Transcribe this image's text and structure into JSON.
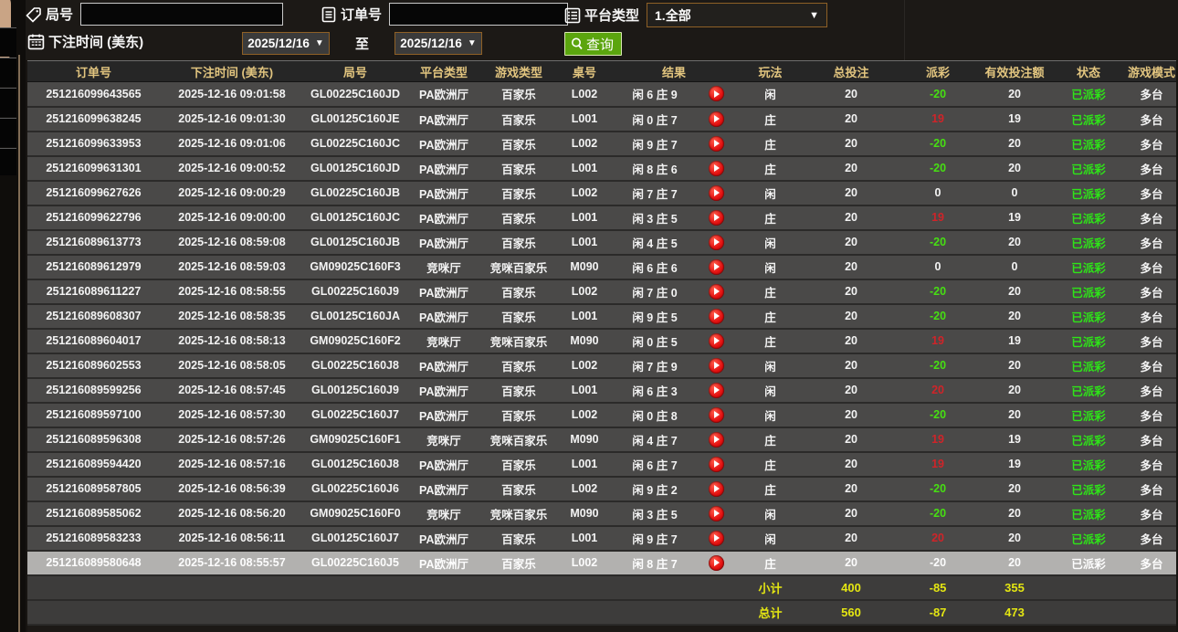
{
  "colors": {
    "accent_gold_header": "#e2c57f",
    "button_green": "#5ba50e",
    "payout_win_red": "#cf2429",
    "payout_loss_green": "#46df12",
    "status_green": "#2ee418",
    "total_yellow": "#e4e612",
    "row_bg": "#4a4948",
    "highlight_row_bg": "#b2b1af",
    "date_border_orange": "#8e6026"
  },
  "filters": {
    "round_label": "局号",
    "order_label": "订单号",
    "platform_label": "平台类型",
    "platform_value": "1.全部",
    "time_label": "下注时间 (美东)",
    "date_from": "2025/12/16",
    "to_label": "至",
    "date_to": "2025/12/16",
    "search_label": "查询",
    "round_value": "",
    "order_value": ""
  },
  "table": {
    "headers": [
      "订单号",
      "下注时间 (美东)",
      "局号",
      "平台类型",
      "游戏类型",
      "桌号",
      "结果",
      "玩法",
      "总投注",
      "派彩",
      "有效投注额",
      "状态",
      "游戏模式"
    ],
    "rows": [
      {
        "order_no": "251216099643565",
        "bet_time": "2025-12-16 09:01:58",
        "round_no": "GL00225C160JD",
        "platform": "PA欧洲厅",
        "game_type": "百家乐",
        "table_no": "L002",
        "result": "闲 6 庄 9",
        "bet_type": "闲",
        "total_bet": "20",
        "payout": "-20",
        "valid_bet": "20",
        "status": "已派彩",
        "game_mode": "多台",
        "highlighted": false
      },
      {
        "order_no": "251216099638245",
        "bet_time": "2025-12-16 09:01:30",
        "round_no": "GL00125C160JE",
        "platform": "PA欧洲厅",
        "game_type": "百家乐",
        "table_no": "L001",
        "result": "闲 0 庄 7",
        "bet_type": "庄",
        "total_bet": "20",
        "payout": "19",
        "valid_bet": "19",
        "status": "已派彩",
        "game_mode": "多台",
        "highlighted": false
      },
      {
        "order_no": "251216099633953",
        "bet_time": "2025-12-16 09:01:06",
        "round_no": "GL00225C160JC",
        "platform": "PA欧洲厅",
        "game_type": "百家乐",
        "table_no": "L002",
        "result": "闲 9 庄 7",
        "bet_type": "庄",
        "total_bet": "20",
        "payout": "-20",
        "valid_bet": "20",
        "status": "已派彩",
        "game_mode": "多台",
        "highlighted": false
      },
      {
        "order_no": "251216099631301",
        "bet_time": "2025-12-16 09:00:52",
        "round_no": "GL00125C160JD",
        "platform": "PA欧洲厅",
        "game_type": "百家乐",
        "table_no": "L001",
        "result": "闲 8 庄 6",
        "bet_type": "庄",
        "total_bet": "20",
        "payout": "-20",
        "valid_bet": "20",
        "status": "已派彩",
        "game_mode": "多台",
        "highlighted": false
      },
      {
        "order_no": "251216099627626",
        "bet_time": "2025-12-16 09:00:29",
        "round_no": "GL00225C160JB",
        "platform": "PA欧洲厅",
        "game_type": "百家乐",
        "table_no": "L002",
        "result": "闲 7 庄 7",
        "bet_type": "闲",
        "total_bet": "20",
        "payout": "0",
        "valid_bet": "0",
        "status": "已派彩",
        "game_mode": "多台",
        "highlighted": false
      },
      {
        "order_no": "251216099622796",
        "bet_time": "2025-12-16 09:00:00",
        "round_no": "GL00125C160JC",
        "platform": "PA欧洲厅",
        "game_type": "百家乐",
        "table_no": "L001",
        "result": "闲 3 庄 5",
        "bet_type": "庄",
        "total_bet": "20",
        "payout": "19",
        "valid_bet": "19",
        "status": "已派彩",
        "game_mode": "多台",
        "highlighted": false
      },
      {
        "order_no": "251216089613773",
        "bet_time": "2025-12-16 08:59:08",
        "round_no": "GL00125C160JB",
        "platform": "PA欧洲厅",
        "game_type": "百家乐",
        "table_no": "L001",
        "result": "闲 4 庄 5",
        "bet_type": "闲",
        "total_bet": "20",
        "payout": "-20",
        "valid_bet": "20",
        "status": "已派彩",
        "game_mode": "多台",
        "highlighted": false
      },
      {
        "order_no": "251216089612979",
        "bet_time": "2025-12-16 08:59:03",
        "round_no": "GM09025C160F3",
        "platform": "竞咪厅",
        "game_type": "竞咪百家乐",
        "table_no": "M090",
        "result": "闲 6 庄 6",
        "bet_type": "闲",
        "total_bet": "20",
        "payout": "0",
        "valid_bet": "0",
        "status": "已派彩",
        "game_mode": "多台",
        "highlighted": false
      },
      {
        "order_no": "251216089611227",
        "bet_time": "2025-12-16 08:58:55",
        "round_no": "GL00225C160J9",
        "platform": "PA欧洲厅",
        "game_type": "百家乐",
        "table_no": "L002",
        "result": "闲 7 庄 0",
        "bet_type": "庄",
        "total_bet": "20",
        "payout": "-20",
        "valid_bet": "20",
        "status": "已派彩",
        "game_mode": "多台",
        "highlighted": false
      },
      {
        "order_no": "251216089608307",
        "bet_time": "2025-12-16 08:58:35",
        "round_no": "GL00125C160JA",
        "platform": "PA欧洲厅",
        "game_type": "百家乐",
        "table_no": "L001",
        "result": "闲 9 庄 5",
        "bet_type": "庄",
        "total_bet": "20",
        "payout": "-20",
        "valid_bet": "20",
        "status": "已派彩",
        "game_mode": "多台",
        "highlighted": false
      },
      {
        "order_no": "251216089604017",
        "bet_time": "2025-12-16 08:58:13",
        "round_no": "GM09025C160F2",
        "platform": "竞咪厅",
        "game_type": "竞咪百家乐",
        "table_no": "M090",
        "result": "闲 0 庄 5",
        "bet_type": "庄",
        "total_bet": "20",
        "payout": "19",
        "valid_bet": "19",
        "status": "已派彩",
        "game_mode": "多台",
        "highlighted": false
      },
      {
        "order_no": "251216089602553",
        "bet_time": "2025-12-16 08:58:05",
        "round_no": "GL00225C160J8",
        "platform": "PA欧洲厅",
        "game_type": "百家乐",
        "table_no": "L002",
        "result": "闲 7 庄 9",
        "bet_type": "闲",
        "total_bet": "20",
        "payout": "-20",
        "valid_bet": "20",
        "status": "已派彩",
        "game_mode": "多台",
        "highlighted": false
      },
      {
        "order_no": "251216089599256",
        "bet_time": "2025-12-16 08:57:45",
        "round_no": "GL00125C160J9",
        "platform": "PA欧洲厅",
        "game_type": "百家乐",
        "table_no": "L001",
        "result": "闲 6 庄 3",
        "bet_type": "闲",
        "total_bet": "20",
        "payout": "20",
        "valid_bet": "20",
        "status": "已派彩",
        "game_mode": "多台",
        "highlighted": false
      },
      {
        "order_no": "251216089597100",
        "bet_time": "2025-12-16 08:57:30",
        "round_no": "GL00225C160J7",
        "platform": "PA欧洲厅",
        "game_type": "百家乐",
        "table_no": "L002",
        "result": "闲 0 庄 8",
        "bet_type": "闲",
        "total_bet": "20",
        "payout": "-20",
        "valid_bet": "20",
        "status": "已派彩",
        "game_mode": "多台",
        "highlighted": false
      },
      {
        "order_no": "251216089596308",
        "bet_time": "2025-12-16 08:57:26",
        "round_no": "GM09025C160F1",
        "platform": "竞咪厅",
        "game_type": "竞咪百家乐",
        "table_no": "M090",
        "result": "闲 4 庄 7",
        "bet_type": "庄",
        "total_bet": "20",
        "payout": "19",
        "valid_bet": "19",
        "status": "已派彩",
        "game_mode": "多台",
        "highlighted": false
      },
      {
        "order_no": "251216089594420",
        "bet_time": "2025-12-16 08:57:16",
        "round_no": "GL00125C160J8",
        "platform": "PA欧洲厅",
        "game_type": "百家乐",
        "table_no": "L001",
        "result": "闲 6 庄 7",
        "bet_type": "庄",
        "total_bet": "20",
        "payout": "19",
        "valid_bet": "19",
        "status": "已派彩",
        "game_mode": "多台",
        "highlighted": false
      },
      {
        "order_no": "251216089587805",
        "bet_time": "2025-12-16 08:56:39",
        "round_no": "GL00225C160J6",
        "platform": "PA欧洲厅",
        "game_type": "百家乐",
        "table_no": "L002",
        "result": "闲 9 庄 2",
        "bet_type": "庄",
        "total_bet": "20",
        "payout": "-20",
        "valid_bet": "20",
        "status": "已派彩",
        "game_mode": "多台",
        "highlighted": false
      },
      {
        "order_no": "251216089585062",
        "bet_time": "2025-12-16 08:56:20",
        "round_no": "GM09025C160F0",
        "platform": "竞咪厅",
        "game_type": "竞咪百家乐",
        "table_no": "M090",
        "result": "闲 3 庄 5",
        "bet_type": "闲",
        "total_bet": "20",
        "payout": "-20",
        "valid_bet": "20",
        "status": "已派彩",
        "game_mode": "多台",
        "highlighted": false
      },
      {
        "order_no": "251216089583233",
        "bet_time": "2025-12-16 08:56:11",
        "round_no": "GL00125C160J7",
        "platform": "PA欧洲厅",
        "game_type": "百家乐",
        "table_no": "L001",
        "result": "闲 9 庄 7",
        "bet_type": "闲",
        "total_bet": "20",
        "payout": "20",
        "valid_bet": "20",
        "status": "已派彩",
        "game_mode": "多台",
        "highlighted": false
      },
      {
        "order_no": "251216089580648",
        "bet_time": "2025-12-16 08:55:57",
        "round_no": "GL00225C160J5",
        "platform": "PA欧洲厅",
        "game_type": "百家乐",
        "table_no": "L002",
        "result": "闲 8 庄 7",
        "bet_type": "庄",
        "total_bet": "20",
        "payout": "-20",
        "valid_bet": "20",
        "status": "已派彩",
        "game_mode": "多台",
        "highlighted": true
      }
    ],
    "subtotal": {
      "label": "小计",
      "total_bet": "400",
      "payout": "-85",
      "valid_bet": "355"
    },
    "grand_total": {
      "label": "总计",
      "total_bet": "560",
      "payout": "-87",
      "valid_bet": "473"
    }
  }
}
